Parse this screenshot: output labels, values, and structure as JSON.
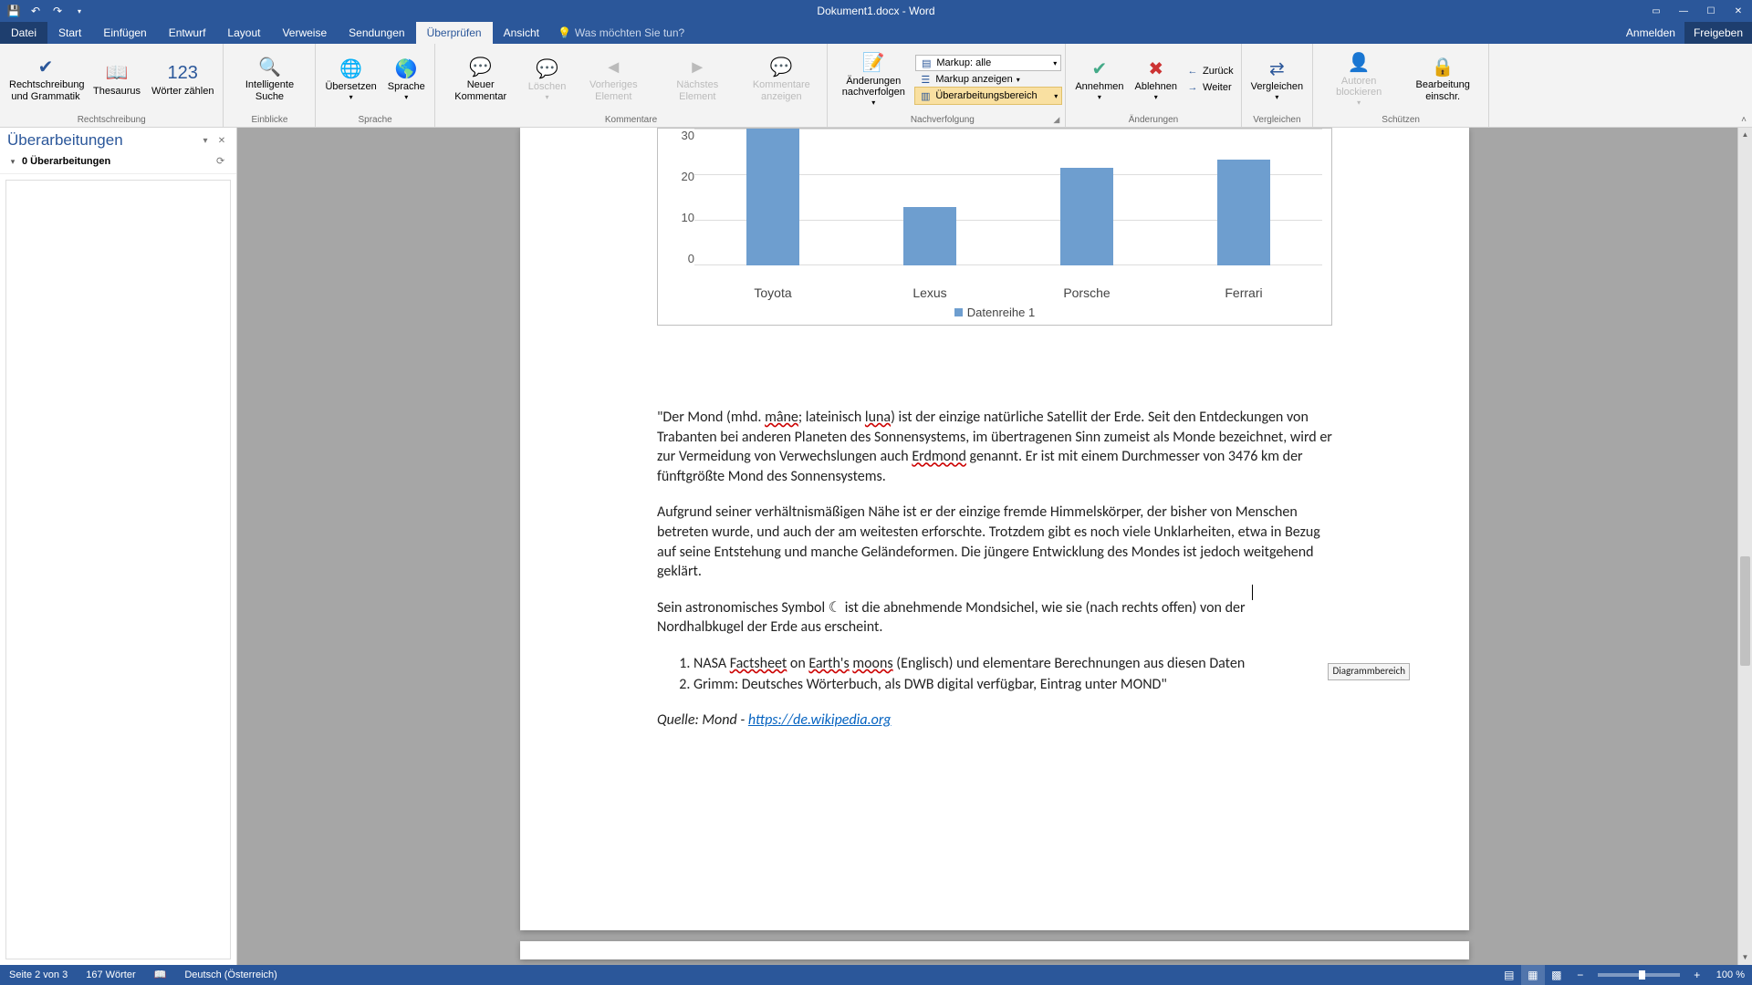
{
  "titlebar": {
    "title": "Dokument1.docx - Word"
  },
  "tabs": {
    "file": "Datei",
    "list": [
      "Start",
      "Einfügen",
      "Entwurf",
      "Layout",
      "Verweise",
      "Sendungen",
      "Überprüfen",
      "Ansicht"
    ],
    "active": 6,
    "tellme_placeholder": "Was möchten Sie tun?",
    "signin": "Anmelden",
    "share": "Freigeben"
  },
  "ribbon": {
    "groups": {
      "proofing": {
        "label": "Rechtschreibung",
        "spelling": "Rechtschreibung und Grammatik",
        "thesaurus": "Thesaurus",
        "wordcount": "Wörter zählen"
      },
      "insights": {
        "label": "Einblicke",
        "smartlookup": "Intelligente Suche"
      },
      "language": {
        "label": "Sprache",
        "translate": "Übersetzen",
        "language": "Sprache"
      },
      "comments": {
        "label": "Kommentare",
        "new": "Neuer Kommentar",
        "delete": "Löschen",
        "prev": "Vorheriges Element",
        "next": "Nächstes Element",
        "show": "Kommentare anzeigen"
      },
      "tracking": {
        "label": "Nachverfolgung",
        "track": "Änderungen nachverfolgen",
        "markup_dd": "Markup: alle",
        "show_markup": "Markup anzeigen",
        "reviewing_pane": "Überarbeitungsbereich"
      },
      "changes": {
        "label": "Änderungen",
        "accept": "Annehmen",
        "reject": "Ablehnen",
        "back": "Zurück",
        "next": "Weiter"
      },
      "compare": {
        "label": "Vergleichen",
        "compare": "Vergleichen"
      },
      "protect": {
        "label": "Schützen",
        "block": "Autoren blockieren",
        "restrict": "Bearbeitung einschr."
      }
    }
  },
  "revpane": {
    "title": "Überarbeitungen",
    "summary": "0 Überarbeitungen"
  },
  "chart_data": {
    "type": "bar",
    "categories": [
      "Toyota",
      "Lexus",
      "Porsche",
      "Ferrari"
    ],
    "values": [
      35,
      15,
      25,
      27
    ],
    "series_name": "Datenreihe 1",
    "yticks": [
      30,
      20,
      10,
      0
    ],
    "ylim": [
      0,
      35
    ],
    "title": "",
    "xlabel": "",
    "ylabel": ""
  },
  "doc": {
    "p1_a": "\"Der Mond (mhd. ",
    "p1_rs1": "mâne",
    "p1_b": "; lateinisch ",
    "p1_rs2": "luna",
    "p1_c": ") ist der einzige natürliche Satellit der Erde. Seit den Entdeckungen von Trabanten bei anderen Planeten des Sonnensystems, im übertragenen Sinn zumeist als Monde bezeichnet, wird er zur Vermeidung von Verwechslungen auch ",
    "p1_rs3": "Erdmond",
    "p1_d": " genannt. Er ist mit einem Durchmesser von 3476 km der fünftgrößte Mond des Sonnensystems.",
    "p2": "Aufgrund seiner verhältnismäßigen Nähe ist er der einzige fremde Himmelskörper, der bisher von Menschen betreten wurde, und auch der am weitesten erforschte. Trotzdem gibt es noch viele Unklarheiten, etwa in Bezug auf seine Entstehung und manche Geländeformen. Die jüngere Entwicklung des Mondes ist jedoch weitgehend geklärt.",
    "p3": "Sein astronomisches Symbol ☾ ist die abnehmende Mondsichel, wie sie (nach rechts offen) von der Nordhalbkugel der Erde aus erscheint.",
    "li1_a": "NASA ",
    "li1_rs1": "Factsheet",
    "li1_b": " on ",
    "li1_rs2": "Earth's",
    "li1_c": " ",
    "li1_rs3": "moons",
    "li1_d": " (Englisch) und elementare Berechnungen aus diesen Daten",
    "li2": "Grimm: Deutsches Wörterbuch, als DWB digital verfügbar, Eintrag unter MOND\"",
    "src_label": "Quelle: Mond - ",
    "src_link": "https://de.wikipedia.org",
    "tooltip": "Diagrammbereich"
  },
  "statusbar": {
    "page": "Seite 2 von 3",
    "words": "167 Wörter",
    "lang": "Deutsch (Österreich)",
    "zoom": "100 %"
  }
}
